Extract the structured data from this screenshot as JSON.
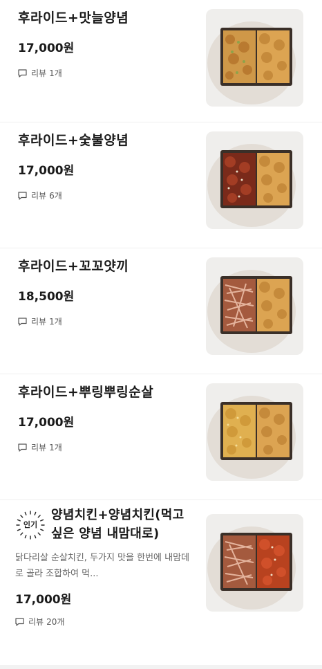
{
  "menu": {
    "items": [
      {
        "name": "후라이드+맛늘양념",
        "price": "17,000원",
        "review_label": "리뷰",
        "review_count": "1개",
        "image_icon": "chicken-box-image",
        "left_food": "fried-chicken-garlic",
        "right_food": "fried-chicken"
      },
      {
        "name": "후라이드+숯불양념",
        "price": "17,000원",
        "review_label": "리뷰",
        "review_count": "6개",
        "image_icon": "chicken-box-image",
        "left_food": "charcoal-sauce-chicken",
        "right_food": "fried-chicken"
      },
      {
        "name": "후라이드+꼬꼬얏끼",
        "price": "18,500원",
        "review_label": "리뷰",
        "review_count": "1개",
        "image_icon": "chicken-box-image",
        "left_food": "bonito-flake-chicken",
        "right_food": "fried-chicken"
      },
      {
        "name": "후라이드+뿌링뿌링순살",
        "price": "17,000원",
        "review_label": "리뷰",
        "review_count": "1개",
        "image_icon": "chicken-box-image",
        "left_food": "seasoned-powder-chicken",
        "right_food": "fried-chicken"
      },
      {
        "badge": "인기",
        "name": "양념치킨+양념치킨(먹고싶은 양념 내맘대로)",
        "description": "닭다리살 순살치킨, 두가지 맛을 한번에 내맘데로 골라 조합하여 먹...",
        "price": "17,000원",
        "review_label": "리뷰",
        "review_count": "20개",
        "image_icon": "chicken-box-image",
        "left_food": "bonito-flake-chicken",
        "right_food": "red-sauce-chicken"
      }
    ]
  },
  "colors": {
    "text": "#1a1a1a",
    "muted": "#666666",
    "thumb_bg": "#efeeec",
    "box": "#3a2f28",
    "fried": "#d49a45",
    "sauce_red": "#9b3220",
    "bonito": "#c7896b"
  }
}
